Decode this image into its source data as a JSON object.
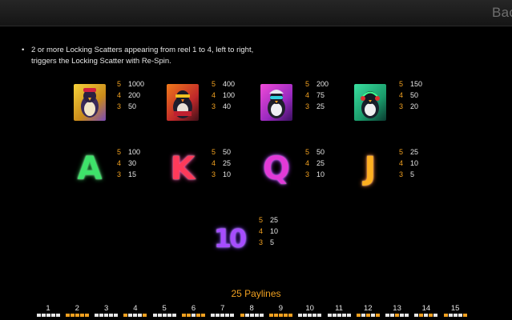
{
  "header": {
    "back_label": "Back"
  },
  "rules": {
    "bullet": "•",
    "text": "2 or more Locking Scatters appearing from reel 1 to 4, left to right, triggers the Locking Scatter with Re-Spin."
  },
  "symbols": [
    {
      "name": "penguin-gold",
      "pays": [
        {
          "count": "5",
          "value": "1000"
        },
        {
          "count": "4",
          "value": "200"
        },
        {
          "count": "3",
          "value": "50"
        }
      ]
    },
    {
      "name": "penguin-red",
      "pays": [
        {
          "count": "5",
          "value": "400"
        },
        {
          "count": "4",
          "value": "100"
        },
        {
          "count": "3",
          "value": "40"
        }
      ]
    },
    {
      "name": "penguin-pink",
      "pays": [
        {
          "count": "5",
          "value": "200"
        },
        {
          "count": "4",
          "value": "75"
        },
        {
          "count": "3",
          "value": "25"
        }
      ]
    },
    {
      "name": "penguin-headphones",
      "pays": [
        {
          "count": "5",
          "value": "150"
        },
        {
          "count": "4",
          "value": "50"
        },
        {
          "count": "3",
          "value": "20"
        }
      ]
    },
    {
      "name": "letter-a",
      "glyph": "A",
      "color": "#3ee26a",
      "pays": [
        {
          "count": "5",
          "value": "100"
        },
        {
          "count": "4",
          "value": "30"
        },
        {
          "count": "3",
          "value": "15"
        }
      ]
    },
    {
      "name": "letter-k",
      "glyph": "K",
      "color": "#ff3a5a",
      "pays": [
        {
          "count": "5",
          "value": "50"
        },
        {
          "count": "4",
          "value": "25"
        },
        {
          "count": "3",
          "value": "10"
        }
      ]
    },
    {
      "name": "letter-q",
      "glyph": "Q",
      "color": "#e23ad8",
      "pays": [
        {
          "count": "5",
          "value": "50"
        },
        {
          "count": "4",
          "value": "25"
        },
        {
          "count": "3",
          "value": "10"
        }
      ]
    },
    {
      "name": "letter-j",
      "glyph": "J",
      "color": "#ffb020",
      "pays": [
        {
          "count": "5",
          "value": "25"
        },
        {
          "count": "4",
          "value": "10"
        },
        {
          "count": "3",
          "value": "5"
        }
      ]
    },
    {
      "name": "number-10",
      "glyph": "10",
      "color": "#a64dff",
      "pays": [
        {
          "count": "5",
          "value": "25"
        },
        {
          "count": "4",
          "value": "10"
        },
        {
          "count": "3",
          "value": "5"
        }
      ]
    }
  ],
  "paylines": {
    "title": "25 Paylines",
    "items": [
      {
        "label": "1",
        "pattern": [
          0,
          0,
          0,
          0,
          0
        ]
      },
      {
        "label": "2",
        "pattern": [
          1,
          1,
          1,
          1,
          1
        ]
      },
      {
        "label": "3",
        "pattern": [
          0,
          0,
          0,
          0,
          0
        ]
      },
      {
        "label": "4",
        "pattern": [
          1,
          0,
          0,
          0,
          1
        ]
      },
      {
        "label": "5",
        "pattern": [
          0,
          0,
          0,
          0,
          0
        ]
      },
      {
        "label": "6",
        "pattern": [
          1,
          1,
          0,
          1,
          1
        ]
      },
      {
        "label": "7",
        "pattern": [
          0,
          0,
          0,
          0,
          0
        ]
      },
      {
        "label": "8",
        "pattern": [
          1,
          0,
          0,
          0,
          0
        ]
      },
      {
        "label": "9",
        "pattern": [
          1,
          1,
          1,
          1,
          1
        ]
      },
      {
        "label": "10",
        "pattern": [
          0,
          0,
          0,
          0,
          0
        ]
      },
      {
        "label": "11",
        "pattern": [
          0,
          0,
          0,
          0,
          0
        ]
      },
      {
        "label": "12",
        "pattern": [
          1,
          0,
          1,
          0,
          1
        ]
      },
      {
        "label": "13",
        "pattern": [
          0,
          0,
          1,
          0,
          0
        ]
      },
      {
        "label": "14",
        "pattern": [
          0,
          1,
          0,
          1,
          0
        ]
      },
      {
        "label": "15",
        "pattern": [
          1,
          0,
          0,
          0,
          1
        ]
      }
    ]
  }
}
